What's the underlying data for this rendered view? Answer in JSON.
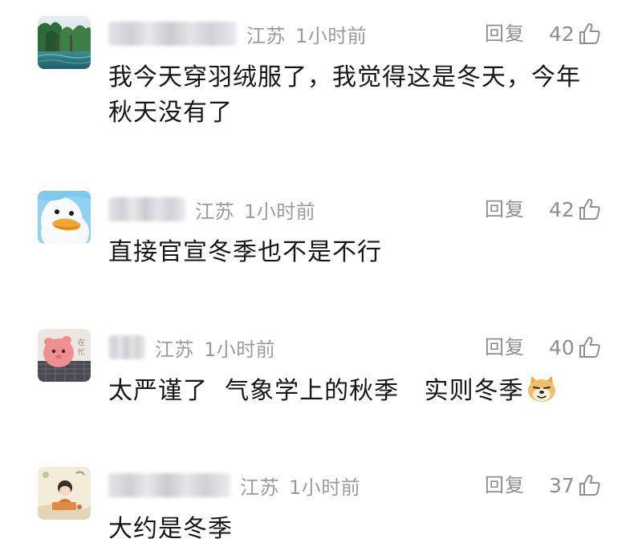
{
  "comments": [
    {
      "region": "江苏",
      "time": "1小时前",
      "reply_label": "回复",
      "likes": "42",
      "text_line1": "我今天穿羽绒服了，我觉得这是冬天，今年",
      "text_line2": "秋天没有了"
    },
    {
      "region": "江苏",
      "time": "1小时前",
      "reply_label": "回复",
      "likes": "42",
      "text": "直接官宣冬季也不是不行"
    },
    {
      "region": "江苏",
      "time": "1小时前",
      "reply_label": "回复",
      "likes": "40",
      "text": "太严谨了  气象学上的秋季   实则冬季"
    },
    {
      "region": "江苏",
      "time": "1小时前",
      "reply_label": "回复",
      "likes": "37",
      "text": "大约是冬季"
    }
  ],
  "icons": {
    "like": "thumbs-up-icon",
    "doge": "doge-emoji-icon"
  },
  "colors": {
    "meta_text": "#9b9b9b",
    "content_text": "#161616",
    "action_text": "#8e8e8e"
  }
}
